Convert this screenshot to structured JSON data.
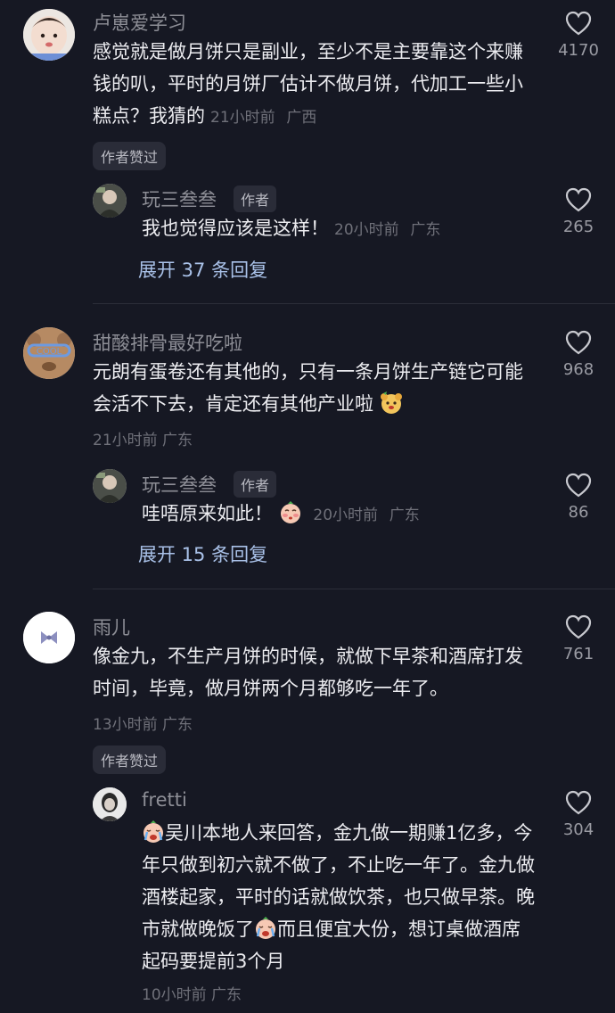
{
  "comments": [
    {
      "username": "卢崽爱学习",
      "text": "感觉就是做月饼只是副业，至少不是主要靠这个来赚钱的叭，平时的月饼厂估计不做月饼，代加工一些小糕点？我猜的",
      "time": "21小时前",
      "location": "广西",
      "likes": "4170",
      "badge": "作者赞过",
      "reply": {
        "username": "玩三叁叁",
        "author_tag": "作者",
        "text": "我也觉得应该是这样！",
        "time": "20小时前",
        "location": "广东",
        "likes": "265"
      },
      "expand_label": "展开 37 条回复"
    },
    {
      "username": "甜酸排骨最好吃啦",
      "text": "元朗有蛋卷还有其他的，只有一条月饼生产链它可能会活不下去，肯定还有其他产业啦",
      "time": "21小时前",
      "location": "广东",
      "likes": "968",
      "reply": {
        "username": "玩三叁叁",
        "author_tag": "作者",
        "text": "哇唔原来如此！",
        "time": "20小时前",
        "location": "广东",
        "likes": "86"
      },
      "expand_label": "展开 15 条回复"
    },
    {
      "username": "雨儿",
      "text": "像金九，不生产月饼的时候，就做下早茶和酒席打发时间，毕竟，做月饼两个月都够吃一年了。",
      "time": "13小时前",
      "location": "广东",
      "likes": "761",
      "badge": "作者赞过",
      "reply": {
        "username": "fretti",
        "text_part1": "吴川本地人来回答，金九做一期赚1亿多，今年只做到初六就不做了，不止吃一年了。金九做酒楼起家，平时的话就做饮茶，也只做早茶。晚市就做晚饭了",
        "text_part2": "而且便宜大份，想订桌做酒席起码要提前3个月",
        "time": "10小时前",
        "location": "广东",
        "likes": "304"
      }
    }
  ],
  "icons": {
    "like": "heart-outline-icon",
    "emoji_bear": "bear-face-emoji-icon",
    "emoji_blush": "blush-face-emoji-icon",
    "emoji_cry": "crying-face-emoji-icon"
  },
  "colors": {
    "background": "#161823",
    "username": "#8d8e96",
    "link": "#a9c1e8"
  }
}
